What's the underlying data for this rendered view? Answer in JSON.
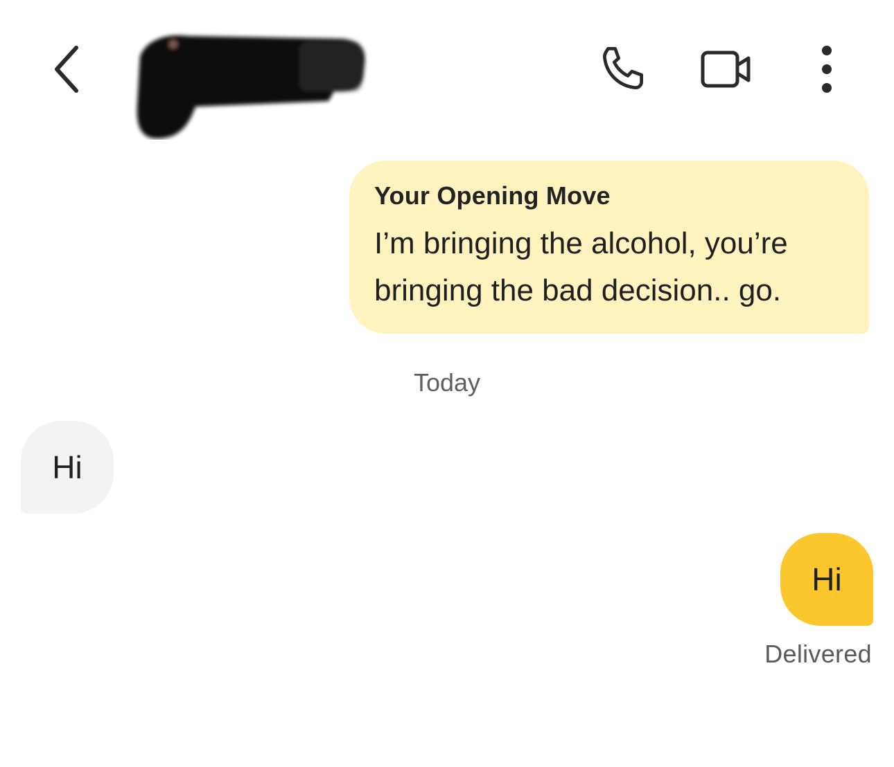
{
  "header": {
    "back_icon": "chevron-left-icon",
    "call_icon": "phone-icon",
    "video_icon": "video-camera-icon",
    "more_icon": "more-vertical-icon",
    "contact_redacted": true
  },
  "opening_move": {
    "title": "Your Opening Move",
    "body": "I’m bringing the alcohol, you’re bringing the bad decision.. go.",
    "background_color": "#fff3bf"
  },
  "divider": {
    "label": "Today"
  },
  "messages": [
    {
      "direction": "incoming",
      "text": "Hi",
      "background_color": "#f3f3f3"
    },
    {
      "direction": "outgoing",
      "text": "Hi",
      "background_color": "#fcc72d"
    }
  ],
  "status": {
    "label": "Delivered"
  }
}
